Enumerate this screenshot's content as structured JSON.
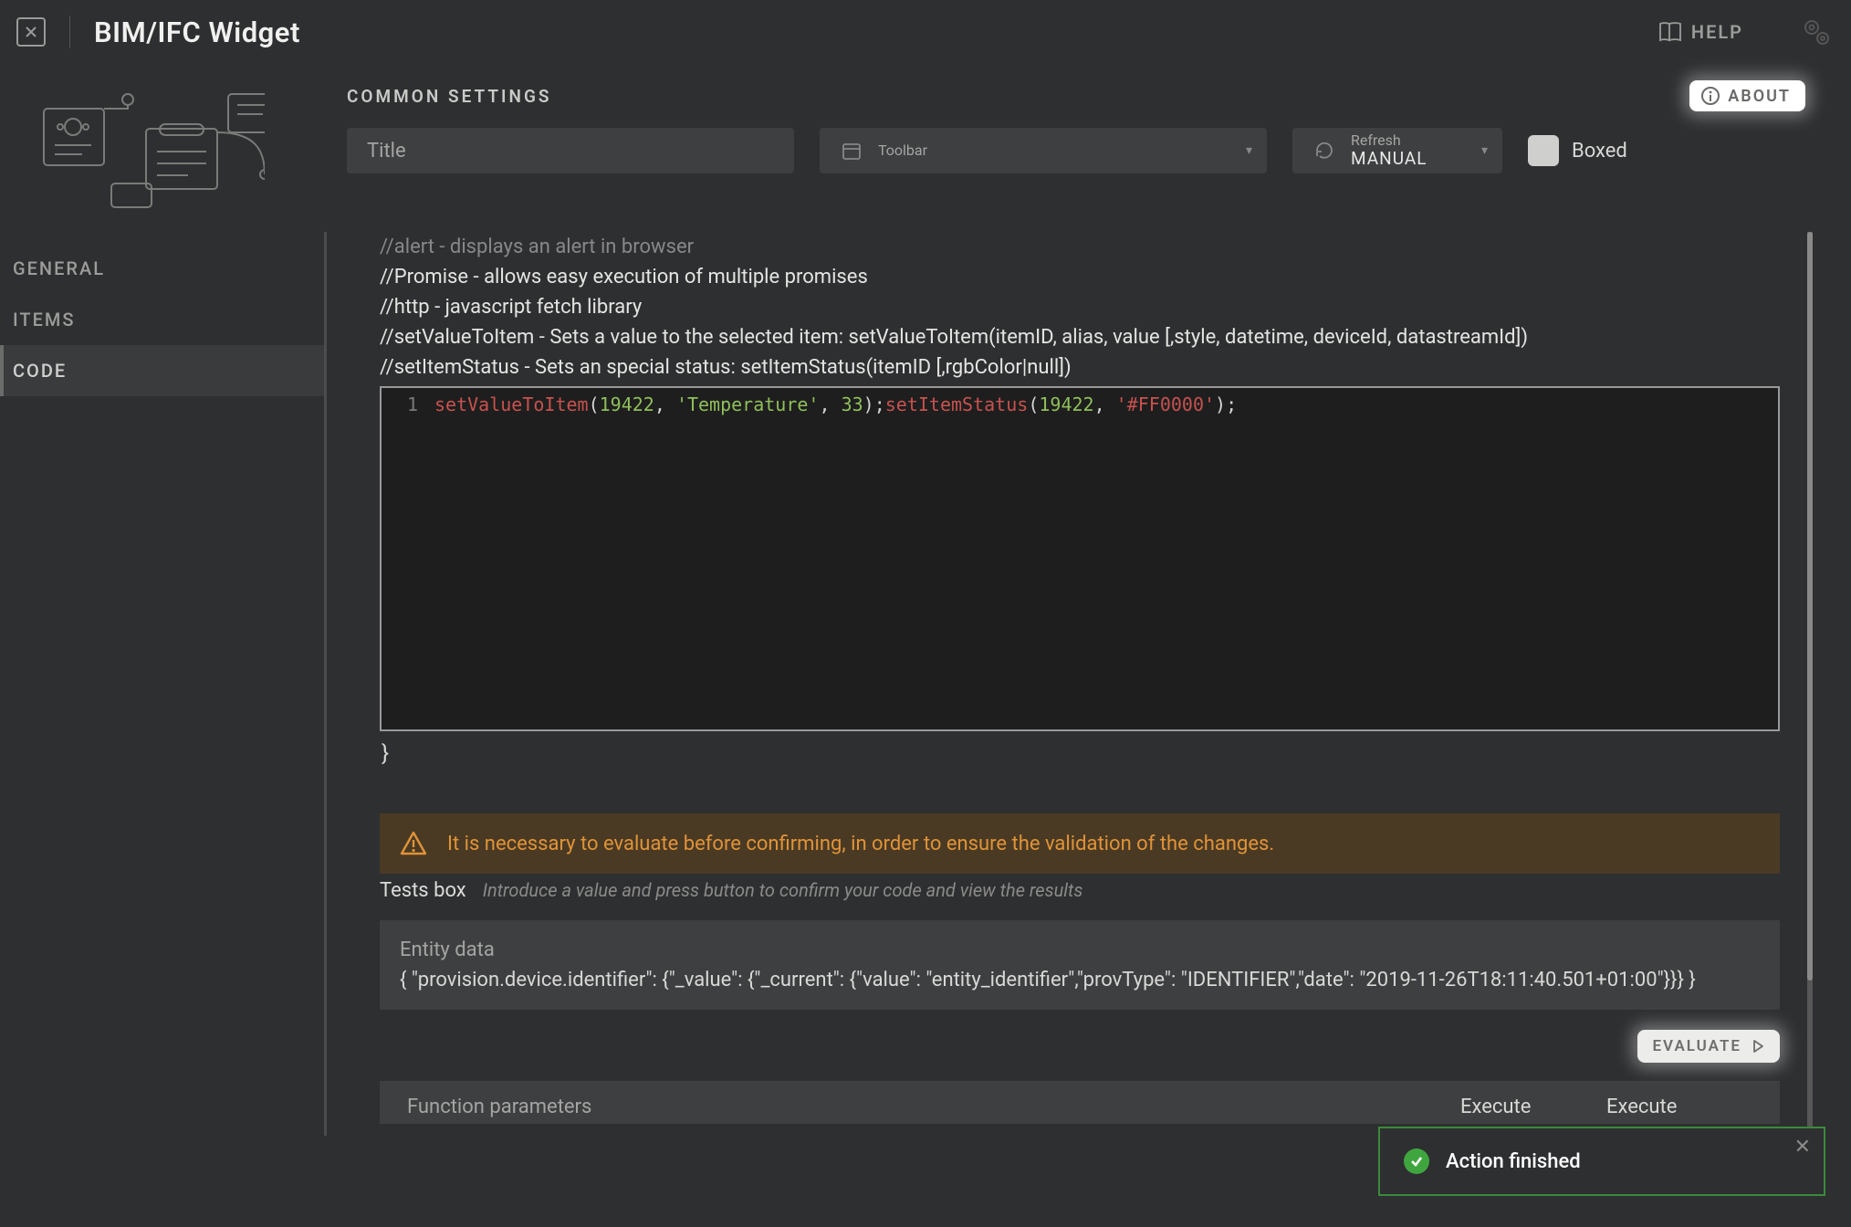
{
  "app_title": "BIM/IFC Widget",
  "help_label": "HELP",
  "settings": {
    "header": "COMMON SETTINGS",
    "about_label": "ABOUT",
    "title_placeholder": "Title",
    "toolbar_label": "Toolbar",
    "refresh_label": "Refresh",
    "refresh_value": "MANUAL",
    "boxed_label": "Boxed"
  },
  "nav": {
    "general": "GENERAL",
    "items": "ITEMS",
    "code": "CODE"
  },
  "comments": {
    "l0": "//alert - displays an alert in browser",
    "l1": "//Promise - allows easy execution of multiple promises",
    "l2": "//http - javascript fetch library",
    "l3": "//setValueToItem - Sets a value to the selected item: setValueToItem(itemID, alias, value [,style, datetime, deviceId, datastreamId])",
    "l4": "//setItemStatus - Sets an special status: setItemStatus(itemID [,rgbColor|null])"
  },
  "code": {
    "line_no": "1",
    "fn1": "setValueToItem",
    "n1": "19422",
    "s1": "'Temperature'",
    "n2": "33",
    "fn2": "setItemStatus",
    "n3": "19422",
    "s2": "'#FF0000'",
    "close_brace": "}"
  },
  "warn": "It is necessary to evaluate before confirming, in order to ensure the validation of the changes.",
  "tests": {
    "title": "Tests box",
    "hint": "Introduce a value and press button to confirm your code and view the results"
  },
  "entity": {
    "label": "Entity data",
    "value": "{ \"provision.device.identifier\": {\"_value\": {\"_current\": {\"value\": \"entity_identifier\",\"provType\": \"IDENTIFIER\",\"date\": \"2019-11-26T18:11:40.501+01:00\"}}} }"
  },
  "evaluate_label": "EVALUATE",
  "params": {
    "label": "Function parameters",
    "col1": "Execute",
    "col2": "Execute"
  },
  "toast": {
    "text": "Action finished"
  }
}
